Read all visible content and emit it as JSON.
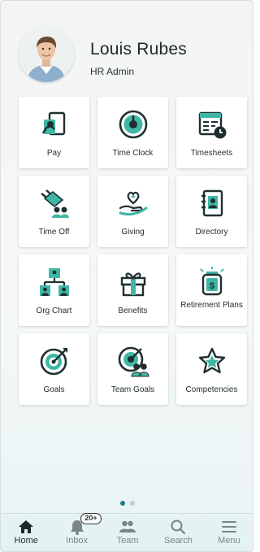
{
  "profile": {
    "name": "Louis Rubes",
    "role": "HR Admin"
  },
  "tiles": [
    {
      "label": "Pay",
      "icon": "pay-icon"
    },
    {
      "label": "Time Clock",
      "icon": "time-clock-icon"
    },
    {
      "label": "Timesheets",
      "icon": "timesheets-icon"
    },
    {
      "label": "Time Off",
      "icon": "time-off-icon"
    },
    {
      "label": "Giving",
      "icon": "giving-icon"
    },
    {
      "label": "Directory",
      "icon": "directory-icon"
    },
    {
      "label": "Org Chart",
      "icon": "org-chart-icon"
    },
    {
      "label": "Benefits",
      "icon": "benefits-icon"
    },
    {
      "label": "Retirement Plans",
      "icon": "retirement-plans-icon"
    },
    {
      "label": "Goals",
      "icon": "goals-icon"
    },
    {
      "label": "Team Goals",
      "icon": "team-goals-icon"
    },
    {
      "label": "Competencies",
      "icon": "competencies-icon"
    }
  ],
  "pager": {
    "pages": 2,
    "current": 1
  },
  "tabbar": {
    "home": "Home",
    "inbox": "Inbox",
    "inbox_badge": "20+",
    "team": "Team",
    "search": "Search",
    "menu": "Menu"
  },
  "colors": {
    "accent": "#1e7e8c",
    "icon_fill": "#3fb7a6",
    "icon_dark": "#1f2f30"
  }
}
